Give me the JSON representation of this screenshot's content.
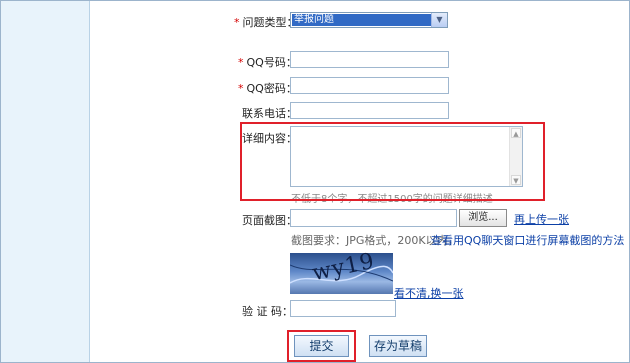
{
  "form": {
    "required_mark": "*",
    "question_type": {
      "label": "问题类型：",
      "value": "举报问题"
    },
    "qq_number": {
      "label": "QQ号码：",
      "value": ""
    },
    "qq_password": {
      "label": "QQ密码：",
      "value": ""
    },
    "phone": {
      "label": "联系电话：",
      "value": ""
    },
    "details": {
      "label": "详细内容：",
      "value": "",
      "hint": "不低于8个字，不超过1500字的问题详细描述"
    },
    "screenshot": {
      "label": "页面截图：",
      "browse_label": "浏览...",
      "reupload_link": "再上传一张",
      "requirement": "截图要求：JPG格式，200K以内，",
      "howto_link": "查看用QQ聊天窗口进行屏幕截图的方法"
    },
    "captcha": {
      "image_text": "wy19",
      "refresh_link": "看不清,换一张"
    },
    "verify": {
      "label": "验 证 码：",
      "value": ""
    },
    "submit_label": "提交",
    "draft_label": "存为草稿"
  },
  "colors": {
    "highlight": "#e0202a",
    "link": "#0b3fa6",
    "required": "#d40000"
  }
}
